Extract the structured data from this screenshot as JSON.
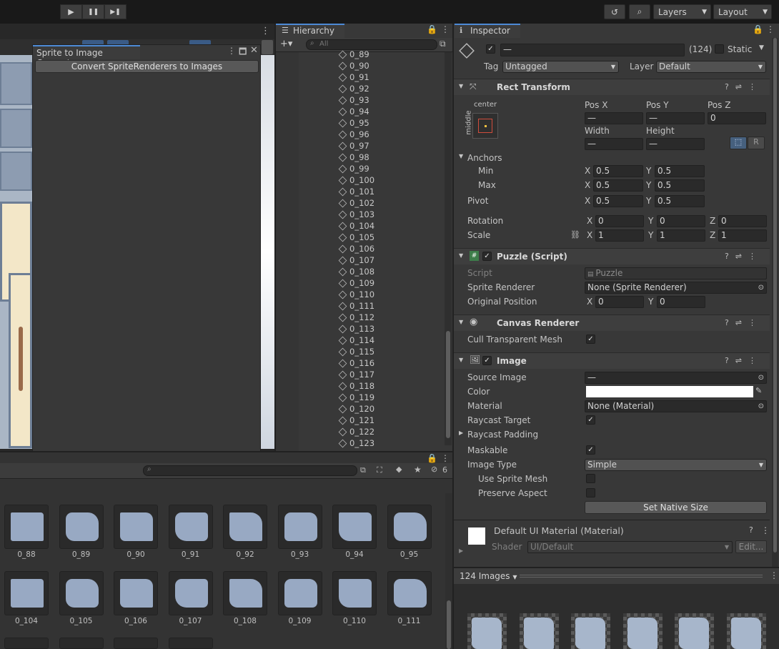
{
  "toolbar": {
    "play": "▶",
    "pause": "❚❚",
    "step": "▶❚",
    "history_icon": "↺",
    "search_icon": "⌕",
    "layers": "Layers",
    "layout": "Layout"
  },
  "scene": {
    "menu": "⋮"
  },
  "converter": {
    "title": "Sprite to Image Converter",
    "button": "Convert SpriteRenderers to Images"
  },
  "hierarchy": {
    "tab": "Hierarchy",
    "add": "+▾",
    "search_placeholder": "All",
    "items": [
      "0_89",
      "0_90",
      "0_91",
      "0_92",
      "0_93",
      "0_94",
      "0_95",
      "0_96",
      "0_97",
      "0_98",
      "0_99",
      "0_100",
      "0_101",
      "0_102",
      "0_103",
      "0_104",
      "0_105",
      "0_106",
      "0_107",
      "0_108",
      "0_109",
      "0_110",
      "0_111",
      "0_112",
      "0_113",
      "0_114",
      "0_115",
      "0_116",
      "0_117",
      "0_118",
      "0_119",
      "0_120",
      "0_121",
      "0_122",
      "0_123"
    ]
  },
  "inspector": {
    "tab": "Inspector",
    "name_value": "—",
    "count": "(124)",
    "static": "Static",
    "tag_label": "Tag",
    "tag_value": "Untagged",
    "layer_label": "Layer",
    "layer_value": "Default",
    "rect": {
      "title": "Rect Transform",
      "anchor_h": "center",
      "anchor_v": "middle",
      "posx": "Pos X",
      "posy": "Pos Y",
      "posz": "Pos Z",
      "posx_v": "—",
      "posy_v": "—",
      "posz_v": "0",
      "width": "Width",
      "height": "Height",
      "width_v": "—",
      "height_v": "—",
      "r": "R",
      "anchors": "Anchors",
      "min": "Min",
      "max": "Max",
      "pivot": "Pivot",
      "rotation": "Rotation",
      "scale": "Scale",
      "x": "X",
      "y": "Y",
      "z": "Z",
      "min_x": "0.5",
      "min_y": "0.5",
      "max_x": "0.5",
      "max_y": "0.5",
      "pivot_x": "0.5",
      "pivot_y": "0.5",
      "rot_x": "0",
      "rot_y": "0",
      "rot_z": "0",
      "sc_x": "1",
      "sc_y": "1",
      "sc_z": "1"
    },
    "puzzle": {
      "title": "Puzzle (Script)",
      "script_label": "Script",
      "script_value": "Puzzle",
      "sr_label": "Sprite Renderer",
      "sr_value": "None (Sprite Renderer)",
      "op_label": "Original Position",
      "op_x": "0",
      "op_y": "0"
    },
    "canvas": {
      "title": "Canvas Renderer",
      "cull": "Cull Transparent Mesh"
    },
    "image": {
      "title": "Image",
      "source": "Source Image",
      "source_v": "—",
      "color": "Color",
      "material": "Material",
      "material_v": "None (Material)",
      "raycast": "Raycast Target",
      "padding": "Raycast Padding",
      "maskable": "Maskable",
      "type": "Image Type",
      "type_v": "Simple",
      "use_mesh": "Use Sprite Mesh",
      "preserve": "Preserve Aspect",
      "native": "Set Native Size"
    },
    "mat": {
      "title": "Default UI Material (Material)",
      "shader": "Shader",
      "shader_v": "UI/Default",
      "edit": "Edit..."
    },
    "preview_label": "124 Images"
  },
  "project": {
    "hidden_count": "6",
    "row1": [
      "0_88",
      "0_89",
      "0_90",
      "0_91",
      "0_92",
      "0_93",
      "0_94",
      "0_95"
    ],
    "row2": [
      "0_104",
      "0_105",
      "0_106",
      "0_107",
      "0_108",
      "0_109",
      "0_110",
      "0_111"
    ]
  }
}
